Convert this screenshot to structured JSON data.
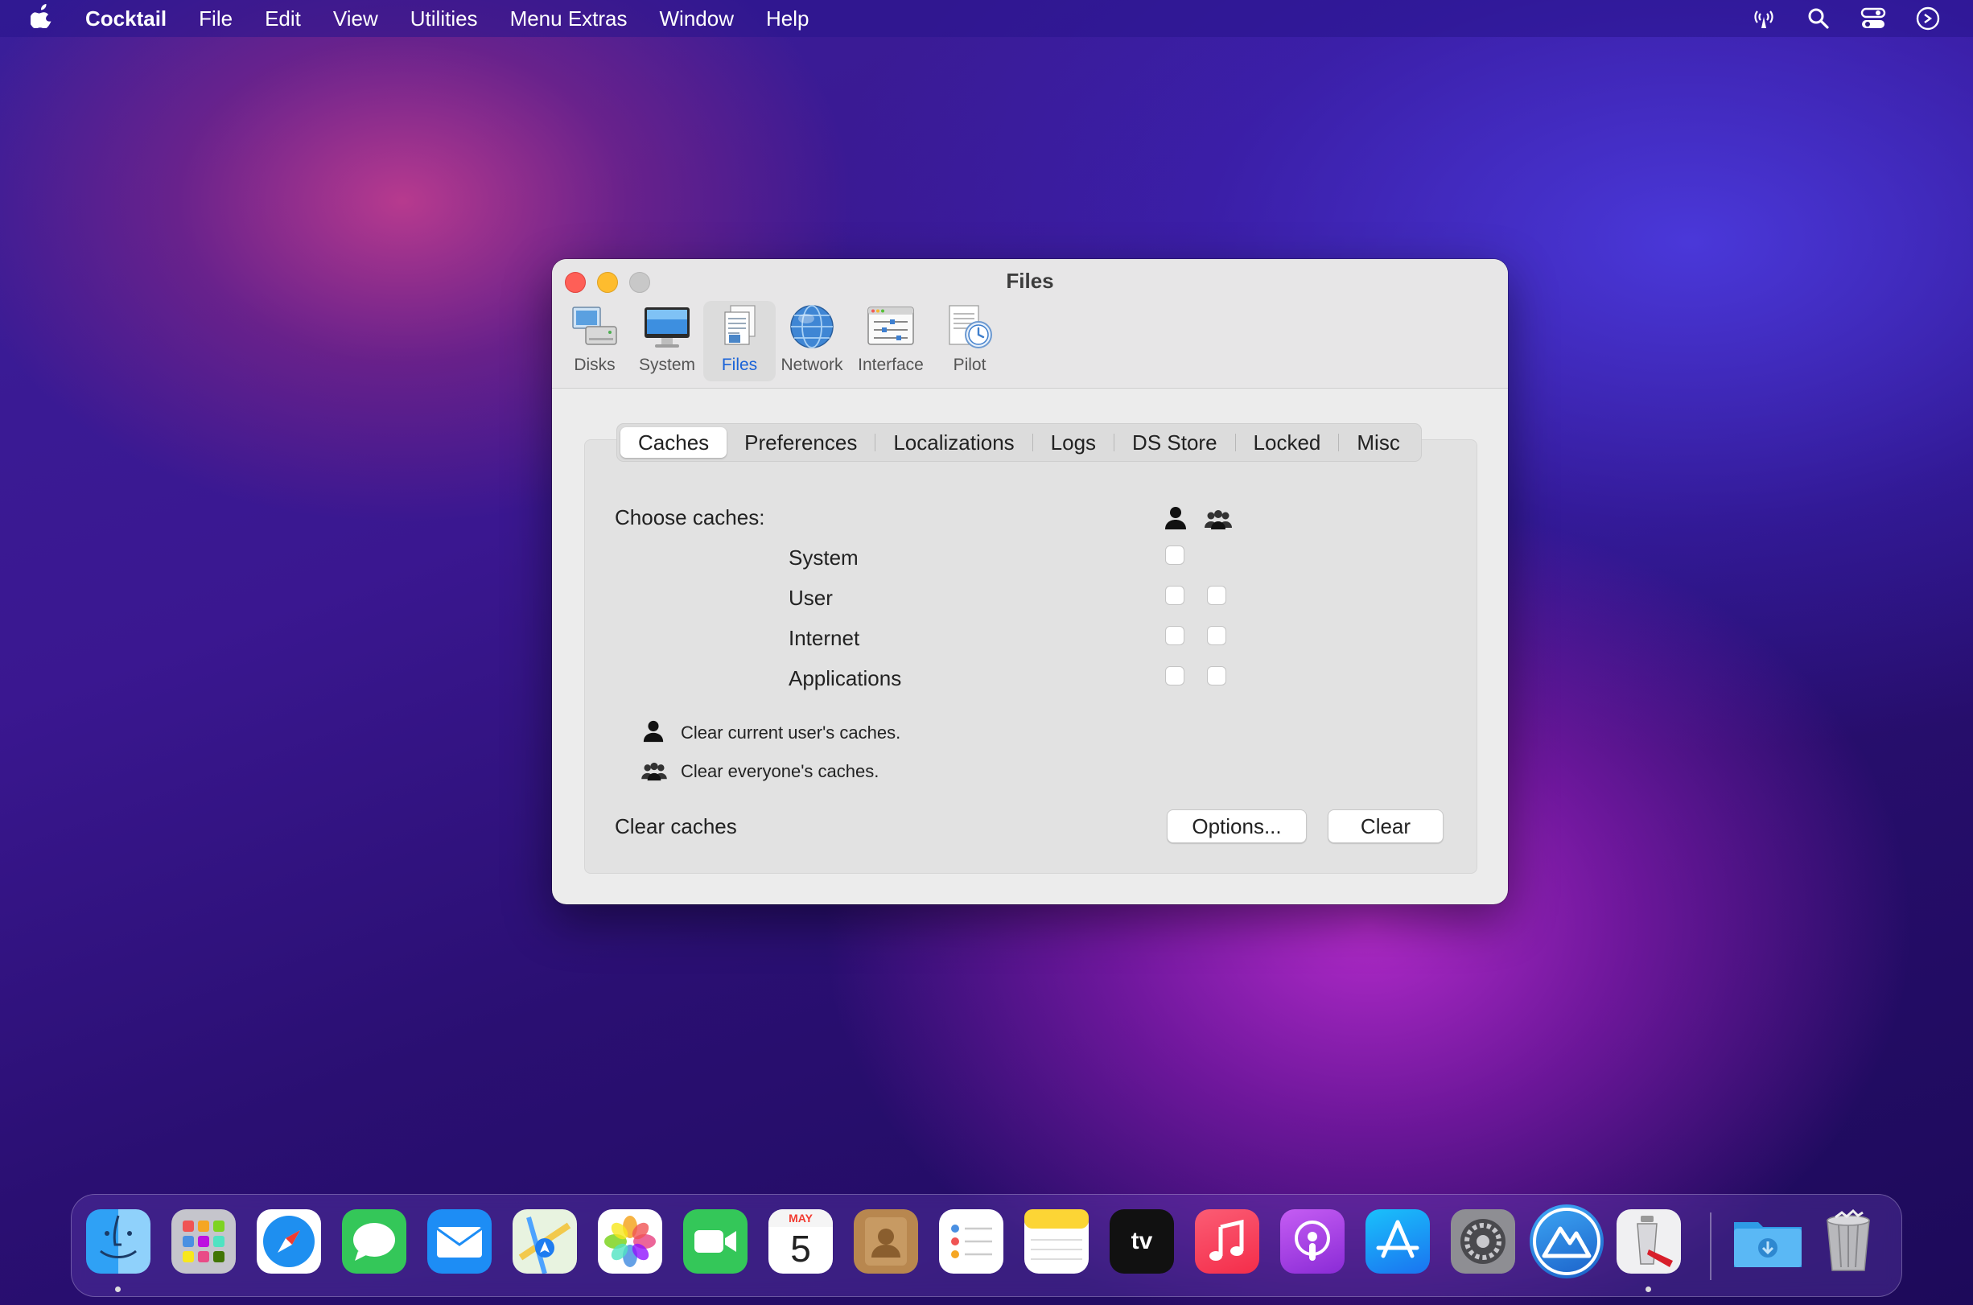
{
  "menubar": {
    "app_name": "Cocktail",
    "items": [
      "File",
      "Edit",
      "View",
      "Utilities",
      "Menu Extras",
      "Window",
      "Help"
    ]
  },
  "window": {
    "title": "Files",
    "toolbar": [
      {
        "label": "Disks",
        "icon": "disks-icon"
      },
      {
        "label": "System",
        "icon": "system-icon"
      },
      {
        "label": "Files",
        "icon": "files-icon",
        "active": true
      },
      {
        "label": "Network",
        "icon": "network-icon"
      },
      {
        "label": "Interface",
        "icon": "interface-icon"
      },
      {
        "label": "Pilot",
        "icon": "pilot-icon"
      }
    ],
    "tabs": [
      "Caches",
      "Preferences",
      "Localizations",
      "Logs",
      "DS Store",
      "Locked",
      "Misc"
    ],
    "active_tab": "Caches",
    "caches": {
      "heading": "Choose caches:",
      "rows": [
        {
          "label": "System",
          "current_user": false
        },
        {
          "label": "User",
          "current_user": false,
          "everyone": false
        },
        {
          "label": "Internet",
          "current_user": false,
          "everyone": false
        },
        {
          "label": "Applications",
          "current_user": false,
          "everyone": false
        }
      ],
      "legend_user": "Clear current user's caches.",
      "legend_everyone": "Clear everyone's caches.",
      "footer_label": "Clear caches",
      "options_button": "Options...",
      "clear_button": "Clear"
    }
  },
  "dock": {
    "calendar_month": "MAY",
    "calendar_day": "5",
    "tv_label": "tv"
  }
}
